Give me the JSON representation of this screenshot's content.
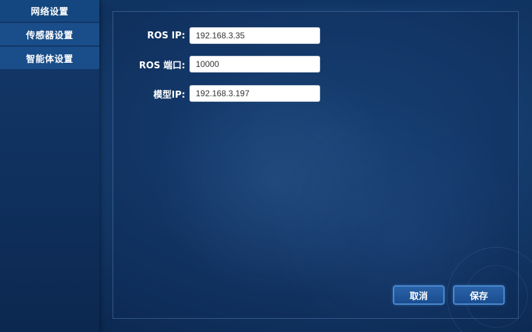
{
  "sidebar": {
    "items": [
      {
        "label": "网络设置",
        "active": true
      },
      {
        "label": "传感器设置",
        "active": false
      },
      {
        "label": "智能体设置",
        "active": false
      }
    ]
  },
  "form": {
    "ros_ip": {
      "label": "ROS IP:",
      "value": "192.168.3.35"
    },
    "ros_port": {
      "label": "ROS 端口:",
      "value": "10000"
    },
    "model_ip": {
      "label": "模型IP:",
      "value": "192.168.3.197"
    }
  },
  "actions": {
    "cancel_label": "取消",
    "save_label": "保存"
  },
  "colors": {
    "background": "#143a6a",
    "sidebar_active": "#14477f",
    "sidebar_item": "#1a4e8a",
    "button": "#1a4d8f"
  }
}
